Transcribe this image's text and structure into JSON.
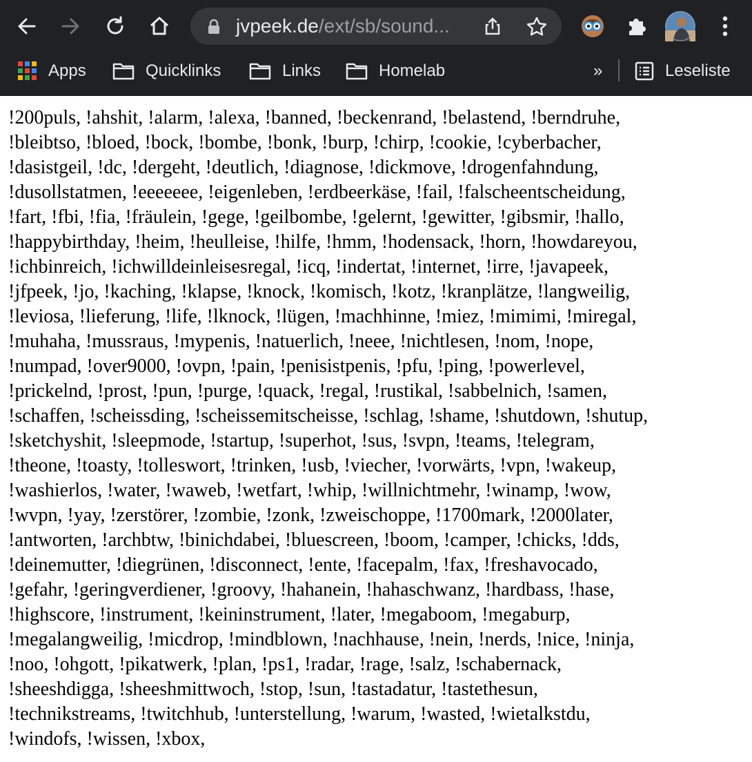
{
  "browser": {
    "url_host": "jvpeek.de",
    "url_path": "/ext/sb/sound...",
    "bookmarks": [
      "Apps",
      "Quicklinks",
      "Links",
      "Homelab"
    ],
    "reading_list": "Leseliste",
    "more_bookmarks": "»"
  },
  "page": {
    "lines": [
      "!200puls, !ahshit, !alarm, !alexa, !banned, !beckenrand, !belastend, !berndruhe,",
      "!bleibtso, !bloed, !bock, !bombe, !bonk, !burp, !chirp, !cookie, !cyberbacher,",
      "!dasistgeil, !dc, !dergeht, !deutlich, !diagnose, !dickmove, !drogenfahndung,",
      "!dusollstatmen, !eeeeeee, !eigenleben, !erdbeerkäse, !fail, !falscheentscheidung,",
      "!fart, !fbi, !fia, !fräulein, !gege, !geilbombe, !gelernt, !gewitter, !gibsmir, !hallo,",
      "!happybirthday, !heim, !heulleise, !hilfe, !hmm, !hodensack, !horn, !howdareyou,",
      "!ichbinreich, !ichwilldeinleisesregal, !icq, !indertat, !internet, !irre, !javapeek,",
      "!jfpeek, !jo, !kaching, !klapse, !knock, !komisch, !kotz, !kranplätze, !langweilig,",
      "!leviosa, !lieferung, !life, !lknock, !lügen, !machhinne, !miez, !mimimi, !miregal,",
      "!muhaha, !mussraus, !mypenis, !natuerlich, !neee, !nichtlesen, !nom, !nope,",
      "!numpad, !over9000, !ovpn, !pain, !penisistpenis, !pfu, !ping, !powerlevel,",
      "!prickelnd, !prost, !pun, !purge, !quack, !regal, !rustikal, !sabbelnich, !samen,",
      "!schaffen, !scheissding, !scheissemitscheisse, !schlag, !shame, !shutdown, !shutup,",
      "!sketchyshit, !sleepmode, !startup, !superhot, !sus, !svpn, !teams, !telegram,",
      "!theone, !toasty, !tolleswort, !trinken, !usb, !viecher, !vorwärts, !vpn, !wakeup,",
      "!washierlos, !water, !waweb, !wetfart, !whip, !willnichtmehr, !winamp, !wow,",
      "!wvpn, !yay, !zerstörer, !zombie, !zonk, !zweischoppe, !1700mark, !2000later,",
      "!antworten, !archbtw, !binichdabei, !bluescreen, !boom, !camper, !chicks, !dds,",
      "!deinemutter, !diegrünen, !disconnect, !ente, !facepalm, !fax, !freshavocado,",
      "!gefahr, !geringverdiener, !groovy, !hahanein, !hahaschwanz, !hardbass, !hase,",
      "!highscore, !instrument, !keininstrument, !later, !megaboom, !megaburp,",
      "!megalangweilig, !micdrop, !mindblown, !nachhause, !nein, !nerds, !nice, !ninja,",
      "!noo, !ohgott, !pikatwerk, !plan, !ps1, !radar, !rage, !salz, !schabernack,",
      "!sheeshdigga, !sheeshmittwoch, !stop, !sun, !tastadatur, !tastethesun,",
      "!technikstreams, !twitchhub, !unterstellung, !warum, !wasted, !wietalkstdu,",
      "!windofs, !wissen, !xbox,"
    ]
  },
  "icons": {
    "back": "arrow-left-icon",
    "forward": "arrow-right-icon",
    "reload": "reload-icon",
    "home": "home-icon",
    "lock": "lock-icon",
    "share": "share-icon",
    "star": "star-icon",
    "extension_glasses": "glasses-extension-icon",
    "extensions": "puzzle-icon",
    "profile": "avatar",
    "menu": "kebab-menu-icon",
    "apps": "apps-grid-icon",
    "folder": "folder-icon",
    "reading_list": "reading-list-icon"
  },
  "colors": {
    "toolbar": "#202124",
    "omnibox": "#35363a",
    "text_light": "#e8eaed",
    "text_muted": "#9aa0a6",
    "page_bg": "#ffffff"
  }
}
